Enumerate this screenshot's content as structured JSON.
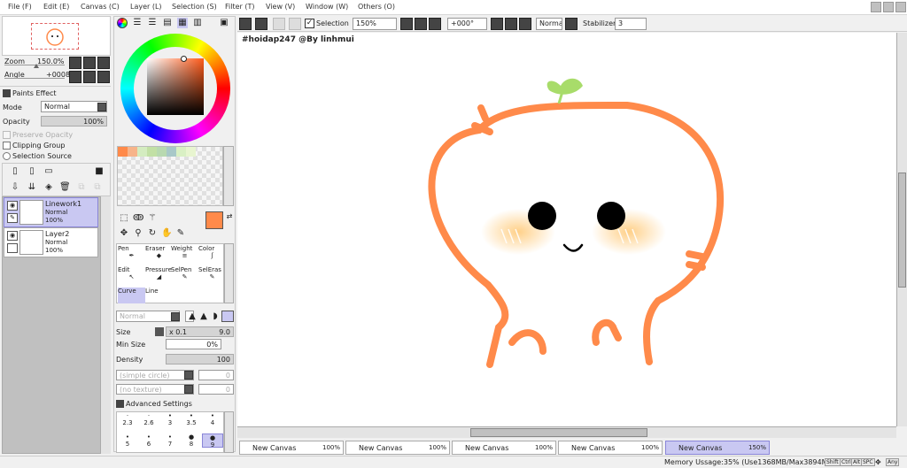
{
  "menu": [
    "File (F)",
    "Edit (E)",
    "Canvas (C)",
    "Layer (L)",
    "Selection (S)",
    "Filter (T)",
    "View (V)",
    "Window (W)",
    "Others (O)"
  ],
  "navigator": {
    "zoom_label": "Zoom",
    "zoom_value": "150.0%",
    "angle_label": "Angle",
    "angle_value": "+0008"
  },
  "paint": {
    "effect_label": "Paints Effect",
    "mode_label": "Mode",
    "mode_value": "Normal",
    "opacity_label": "Opacity",
    "opacity_value": "100%",
    "preserve_label": "Preserve Opacity",
    "clipping_label": "Clipping Group",
    "selsource_label": "Selection Source"
  },
  "layers": [
    {
      "name": "Linework1",
      "mode": "Normal",
      "opacity": "100%",
      "selected": true
    },
    {
      "name": "Layer2",
      "mode": "Normal",
      "opacity": "100%",
      "selected": false
    }
  ],
  "colors": {
    "primary": "#ff8a4a",
    "secondary": "#ffffff",
    "accent": "#c9c8f2",
    "swatches": [
      "#ff8a4a",
      "#f7b48a",
      "#d4ecc0",
      "#c2e0a5",
      "#b8d9b0",
      "#a8c8c8",
      "#d9f0c4",
      "#e8f5d0"
    ]
  },
  "tools": [
    {
      "label": "Pen"
    },
    {
      "label": "Eraser"
    },
    {
      "label": "Weight"
    },
    {
      "label": "Color"
    },
    {
      "label": "Edit"
    },
    {
      "label": "Pressure"
    },
    {
      "label": "SelPen"
    },
    {
      "label": "SelEras"
    },
    {
      "label": "Curve"
    },
    {
      "label": "Line"
    }
  ],
  "brush": {
    "blend_value": "Normal",
    "size_label": "Size",
    "size_mult": "x 0.1",
    "size_value": "9.0",
    "minsize_label": "Min Size",
    "minsize_value": "0%",
    "density_label": "Density",
    "density_value": "100",
    "shape_value": "(simple circle)",
    "shape_num": "0",
    "texture_value": "(no texture)",
    "texture_num": "0",
    "advanced_label": "Advanced Settings",
    "sizes_row1": [
      "2.3",
      "2.6",
      "3",
      "3.5",
      "4"
    ],
    "sizes_row2": [
      "5",
      "6",
      "7",
      "8",
      "9"
    ],
    "selected_size": "9"
  },
  "toolbar": {
    "selection_label": "Selection",
    "zoom_value": "150%",
    "angle_value": "+000°",
    "blend_value": "Normal",
    "stabilizer_label": "Stabilizer",
    "stabilizer_value": "3"
  },
  "canvas": {
    "caption": "#hoidap247 @By linhmui"
  },
  "tabs": [
    {
      "name": "New Canvas",
      "zoom": "100%",
      "selected": false
    },
    {
      "name": "New Canvas",
      "zoom": "100%",
      "selected": false
    },
    {
      "name": "New Canvas",
      "zoom": "100%",
      "selected": false
    },
    {
      "name": "New Canvas",
      "zoom": "100%",
      "selected": false
    },
    {
      "name": "New Canvas",
      "zoom": "150%",
      "selected": true
    }
  ],
  "status": {
    "memory": "Memory Ussage:35% (Use1368MB/Max3894MB)",
    "keys": [
      "Shift",
      "Ctrl",
      "Alt",
      "SPC",
      "Any"
    ]
  }
}
